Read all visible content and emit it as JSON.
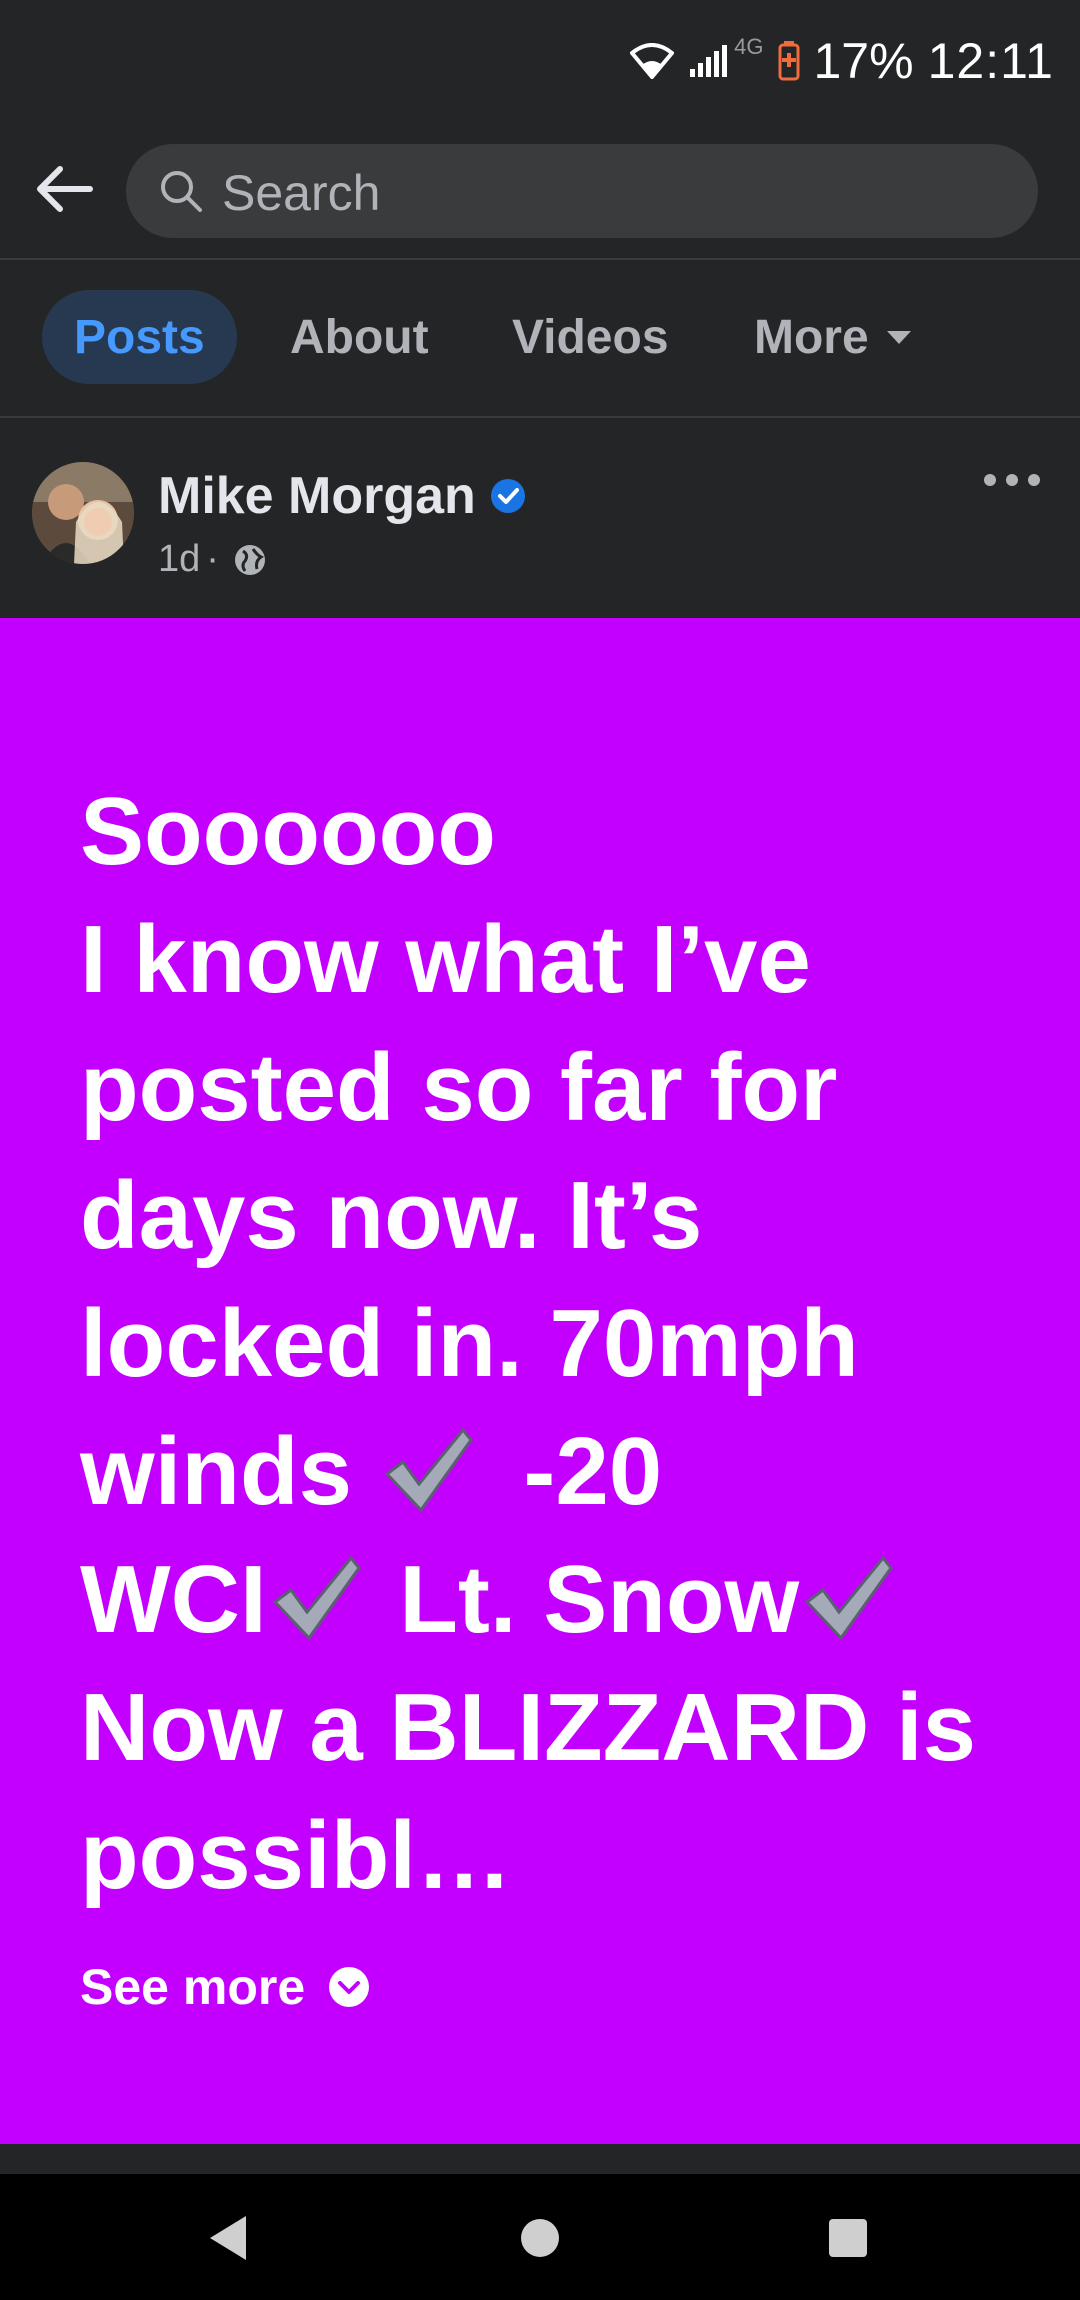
{
  "status_bar": {
    "network": "4G",
    "battery_percent": "17%",
    "time": "12:11"
  },
  "search": {
    "placeholder": "Search"
  },
  "tabs": [
    {
      "label": "Posts",
      "active": true
    },
    {
      "label": "About",
      "active": false
    },
    {
      "label": "Videos",
      "active": false
    },
    {
      "label": "More",
      "active": false
    }
  ],
  "post": {
    "author": "Mike Morgan",
    "verified": true,
    "time_ago": "1d",
    "separator": "·",
    "audience_icon": "globe-icon",
    "background_color": "#c300ff",
    "text_lines": [
      "Soooooo",
      "I know what I’ve",
      "posted so far for",
      "days now. It’s",
      "locked in. 70mph",
      "winds",
      "-20",
      "WCI",
      "Lt. Snow",
      "Now a BLIZZARD is",
      "possibl…"
    ],
    "see_more_label": "See more"
  },
  "colors": {
    "accent": "#4599ff",
    "surface": "#242526",
    "input": "#3a3b3c"
  }
}
